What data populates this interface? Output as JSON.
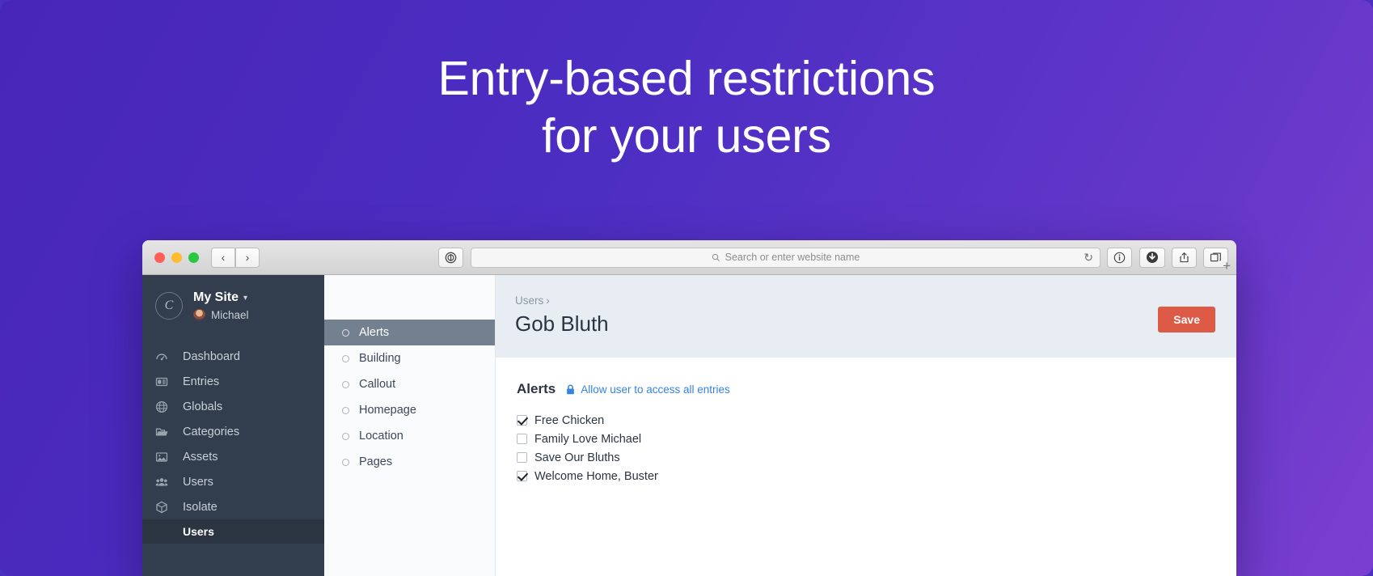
{
  "hero": {
    "headline_line1": "Entry-based restrictions",
    "headline_line2": "for your users",
    "background_color": "#4d2ec3"
  },
  "browser": {
    "traffic_lights": [
      "close",
      "minimize",
      "zoom"
    ],
    "back_label": "‹",
    "forward_label": "›",
    "sidebar_toggle_icon": "sidebar-icon",
    "address_placeholder": "Search or enter website name",
    "search_icon": "search-icon",
    "reload_icon": "reload-icon",
    "info_icon": "info-icon",
    "download_icon": "download-icon",
    "share_icon": "share-icon",
    "tabs_icon": "tabs-icon",
    "new_tab_label": "+"
  },
  "sidebar": {
    "site_logo_letter": "C",
    "site_name": "My Site",
    "site_chevron": "⌄",
    "user_name": "Michael",
    "items": [
      {
        "label": "Dashboard",
        "icon": "dashboard-icon"
      },
      {
        "label": "Entries",
        "icon": "entries-icon"
      },
      {
        "label": "Globals",
        "icon": "globe-icon"
      },
      {
        "label": "Categories",
        "icon": "folder-icon"
      },
      {
        "label": "Assets",
        "icon": "image-icon"
      },
      {
        "label": "Users",
        "icon": "users-icon"
      },
      {
        "label": "Isolate",
        "icon": "cube-icon"
      }
    ],
    "sub_item": {
      "label": "Users",
      "active": true
    }
  },
  "subnav": {
    "items": [
      {
        "label": "Alerts",
        "active": true
      },
      {
        "label": "Building",
        "active": false
      },
      {
        "label": "Callout",
        "active": false
      },
      {
        "label": "Homepage",
        "active": false
      },
      {
        "label": "Location",
        "active": false
      },
      {
        "label": "Pages",
        "active": false
      }
    ]
  },
  "header": {
    "breadcrumb": "Users",
    "breadcrumb_separator": "›",
    "title": "Gob Bluth",
    "save_label": "Save",
    "save_color": "#dd5a47"
  },
  "content": {
    "section_title": "Alerts",
    "allow_link_label": "Allow user to access all entries",
    "allow_link_color": "#3583e0",
    "entries": [
      {
        "label": "Free Chicken",
        "checked": true
      },
      {
        "label": "Family Love Michael",
        "checked": false
      },
      {
        "label": "Save Our Bluths",
        "checked": false
      },
      {
        "label": "Welcome Home, Buster",
        "checked": true
      }
    ]
  }
}
